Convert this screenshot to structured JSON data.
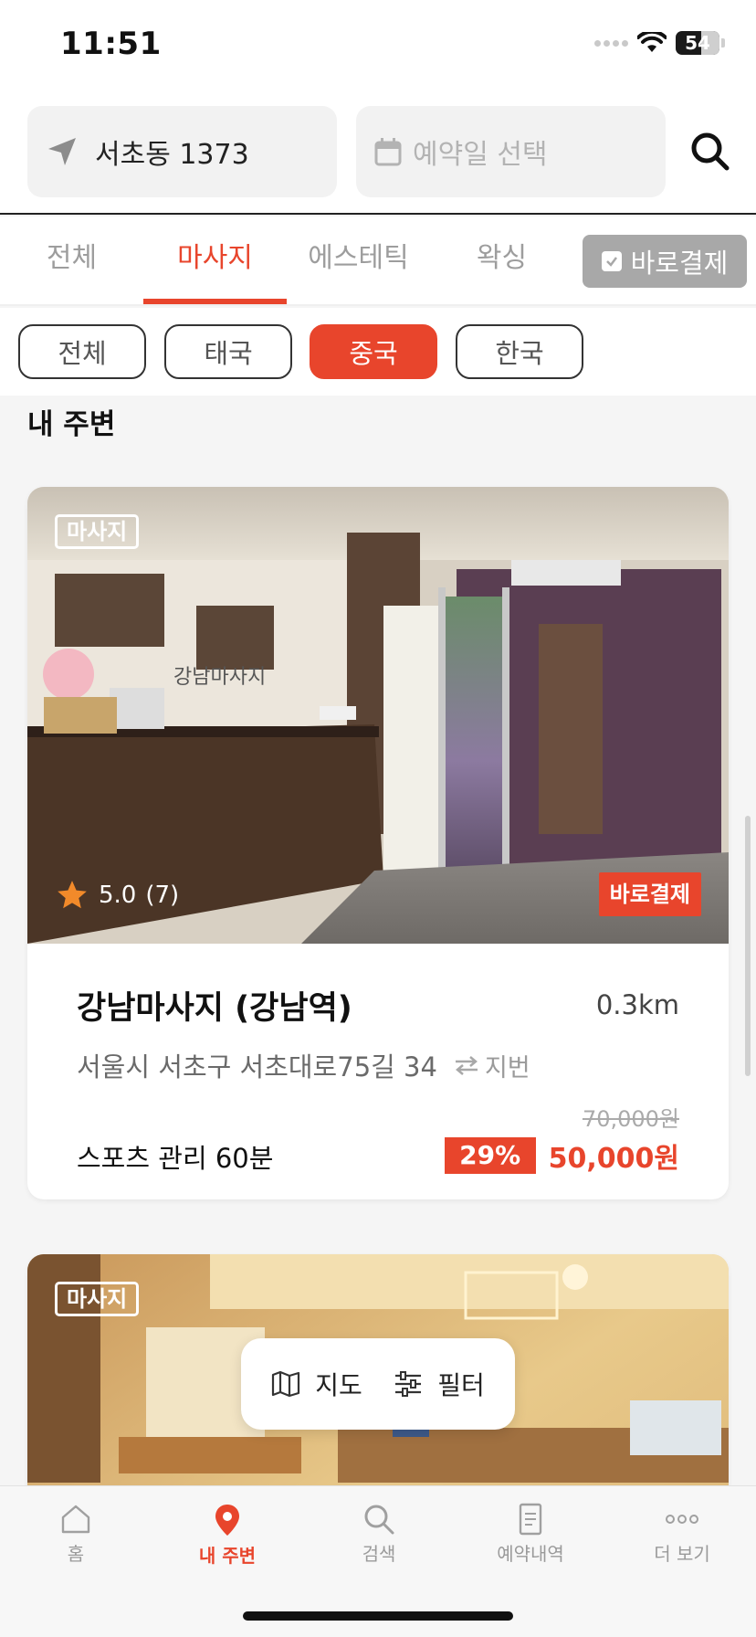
{
  "status_bar": {
    "time": "11:51",
    "battery": "54"
  },
  "header": {
    "location": "서초동 1373",
    "date_placeholder": "예약일 선택"
  },
  "category_tabs": {
    "items": [
      {
        "label": "전체",
        "active": false
      },
      {
        "label": "마사지",
        "active": true
      },
      {
        "label": "에스테틱",
        "active": false
      },
      {
        "label": "왁싱",
        "active": false
      }
    ],
    "quick_pay_label": "바로결제",
    "quick_pay_checked": true
  },
  "sub_chips": {
    "items": [
      {
        "label": "전체",
        "active": false
      },
      {
        "label": "태국",
        "active": false
      },
      {
        "label": "중국",
        "active": true
      },
      {
        "label": "한국",
        "active": false
      }
    ]
  },
  "section_title": "내 주변",
  "cards": [
    {
      "tag": "마사지",
      "rating": "5.0",
      "review_count": "(7)",
      "quick_badge": "바로결제",
      "name": "강남마사지 (강남역)",
      "distance": "0.3km",
      "address": "서울시 서초구 서초대로75길 34",
      "address_toggle": "지번",
      "original_price": "70,000원",
      "service": "스포츠 관리 60분",
      "discount": "29%",
      "price": "50,000원"
    },
    {
      "tag": "마사지"
    }
  ],
  "floating": {
    "map_label": "지도",
    "filter_label": "필터"
  },
  "tab_bar": {
    "items": [
      {
        "label": "홈",
        "icon": "home-icon",
        "active": false
      },
      {
        "label": "내 주변",
        "icon": "location-pin-icon",
        "active": true
      },
      {
        "label": "검색",
        "icon": "search-icon",
        "active": false
      },
      {
        "label": "예약내역",
        "icon": "document-icon",
        "active": false
      },
      {
        "label": "더 보기",
        "icon": "more-icon",
        "active": false
      }
    ]
  },
  "colors": {
    "accent": "#e8452c",
    "inactive": "#9d9d9d"
  }
}
